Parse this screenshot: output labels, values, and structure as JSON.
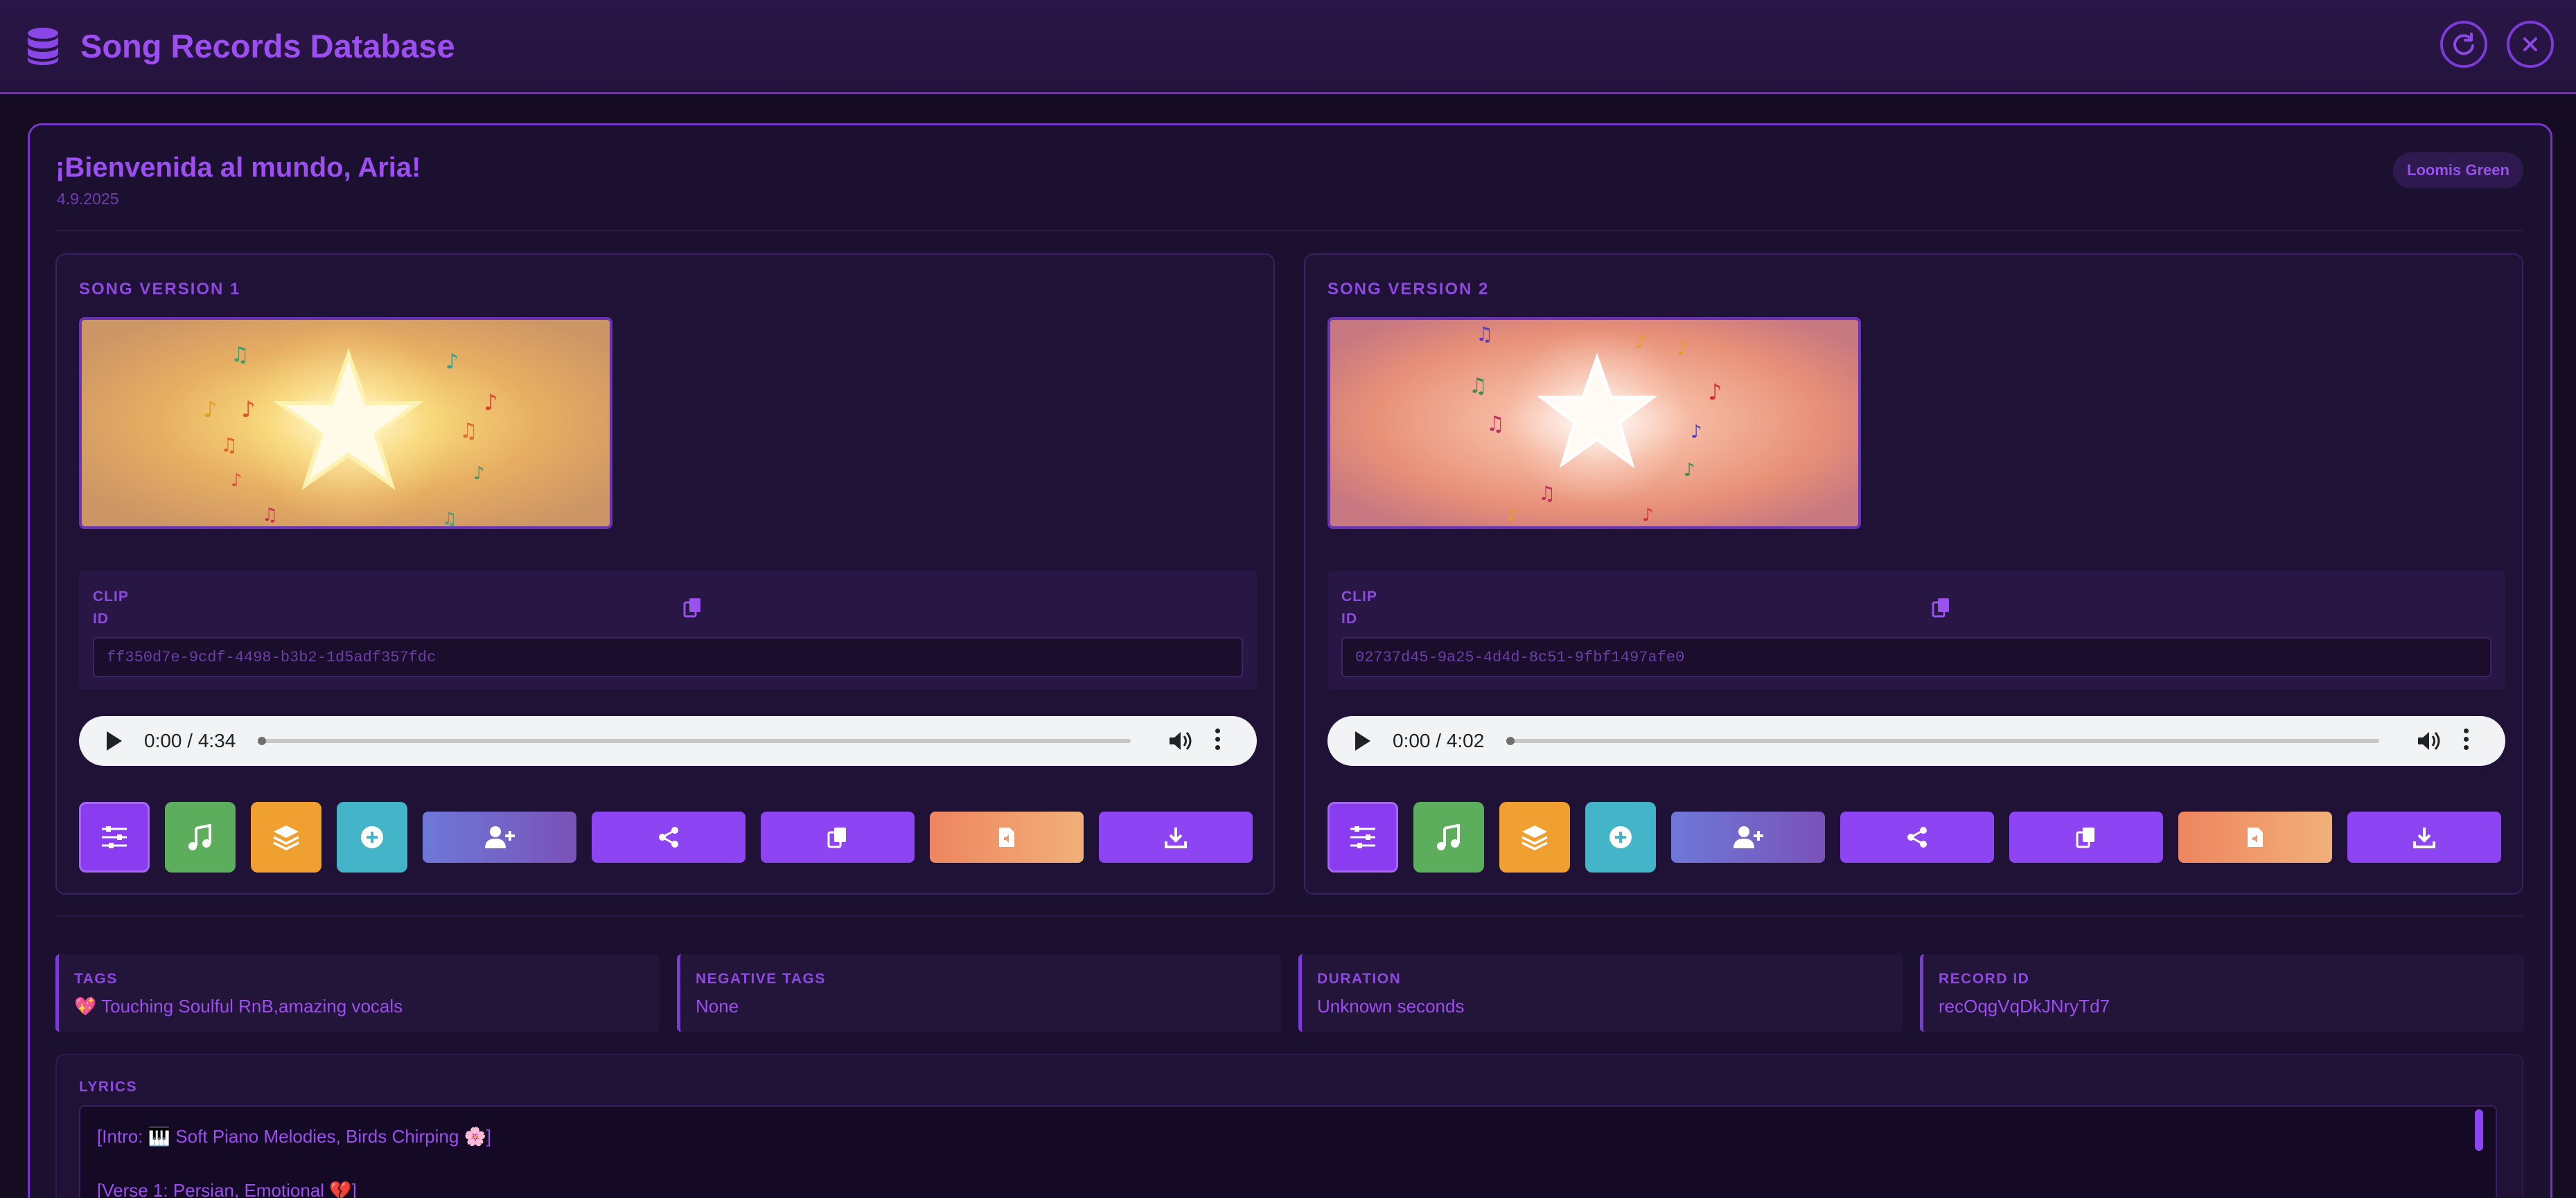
{
  "app": {
    "title": "Song Records Database",
    "icon": "database-icon",
    "header_buttons": [
      "refresh-icon",
      "close-icon"
    ]
  },
  "record": {
    "greeting": "¡Bienvenida al mundo, Aria!",
    "date": "4.9.2025",
    "owner": "Loomis Green"
  },
  "versions": [
    {
      "title": "SONG VERSION 1",
      "clip_label_1": "CLIP",
      "clip_label_2": "ID",
      "clip_id": "ff350d7e-9cdf-4498-b3b2-1d5adf357fdc",
      "player_time": "0:00 / 4:34"
    },
    {
      "title": "SONG VERSION 2",
      "clip_label_1": "CLIP",
      "clip_label_2": "ID",
      "clip_id": "02737d45-9a25-4d4d-8c51-9fbf1497afe0",
      "player_time": "0:00 / 4:02"
    }
  ],
  "action_icons": [
    "sliders-icon",
    "music-note-icon",
    "layers-icon",
    "add-disc-icon",
    "add-user-icon",
    "share-icon",
    "copy-icon",
    "audio-file-icon",
    "download-icon"
  ],
  "info": {
    "tags_label": "TAGS",
    "tags_value": "💖 Touching Soulful RnB,amazing vocals",
    "negative_tags_label": "NEGATIVE TAGS",
    "negative_tags_value": "None",
    "duration_label": "DURATION",
    "duration_value": "Unknown seconds",
    "record_id_label": "RECORD ID",
    "record_id_value": "recOqgVqDkJNryTd7"
  },
  "lyrics": {
    "label": "LYRICS",
    "lines": [
      "[Intro: 🎹 Soft Piano Melodies, Birds Chirping 🌸]",
      "[Verse 1: Persian, Emotional 💔]"
    ]
  },
  "colors": {
    "accent": "#9d4ef0",
    "background": "#150c22",
    "green": "#5cad5c",
    "orange": "#f0a030",
    "teal": "#44b4c8"
  }
}
